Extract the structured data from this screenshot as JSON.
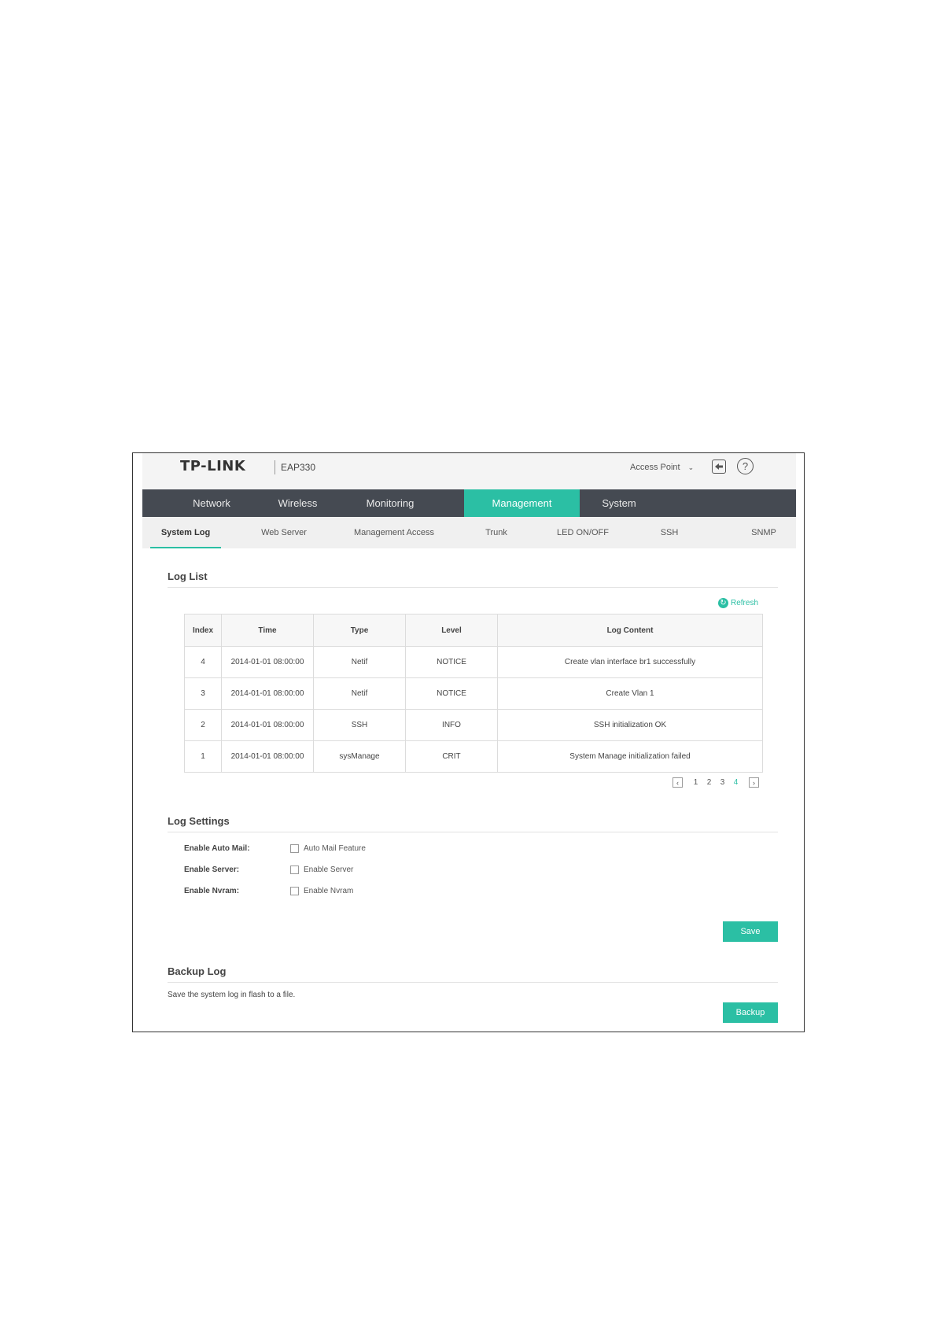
{
  "header": {
    "logo": "TP-LINK",
    "model": "EAP330",
    "mode": "Access Point"
  },
  "main_nav": [
    "Network",
    "Wireless",
    "Monitoring",
    "Management",
    "System"
  ],
  "main_nav_active": "Management",
  "sub_nav": [
    "System Log",
    "Web Server",
    "Management Access",
    "Trunk",
    "LED ON/OFF",
    "SSH",
    "SNMP"
  ],
  "sub_nav_active": "System Log",
  "log_list": {
    "title": "Log List",
    "refresh_label": "Refresh",
    "columns": [
      "Index",
      "Time",
      "Type",
      "Level",
      "Log Content"
    ],
    "rows": [
      [
        "4",
        "2014-01-01 08:00:00",
        "Netif",
        "NOTICE",
        "Create vlan interface br1 successfully"
      ],
      [
        "3",
        "2014-01-01 08:00:00",
        "Netif",
        "NOTICE",
        "Create Vlan 1"
      ],
      [
        "2",
        "2014-01-01 08:00:00",
        "SSH",
        "INFO",
        "SSH initialization OK"
      ],
      [
        "1",
        "2014-01-01 08:00:00",
        "sysManage",
        "CRIT",
        "System Manage initialization failed"
      ]
    ],
    "pagination": {
      "prev": "‹",
      "next": "›",
      "pages": [
        "1",
        "2",
        "3",
        "4"
      ],
      "current": "4"
    }
  },
  "log_settings": {
    "title": "Log Settings",
    "fields": [
      {
        "label": "Enable Auto Mail:",
        "option": "Auto Mail Feature"
      },
      {
        "label": "Enable Server:",
        "option": "Enable Server"
      },
      {
        "label": "Enable Nvram:",
        "option": "Enable Nvram"
      }
    ],
    "save_label": "Save"
  },
  "backup_log": {
    "title": "Backup Log",
    "description": "Save the system log in flash to a file.",
    "backup_label": "Backup"
  },
  "colors": {
    "accent": "#2bbfa4",
    "nav_bg": "#454a52"
  }
}
